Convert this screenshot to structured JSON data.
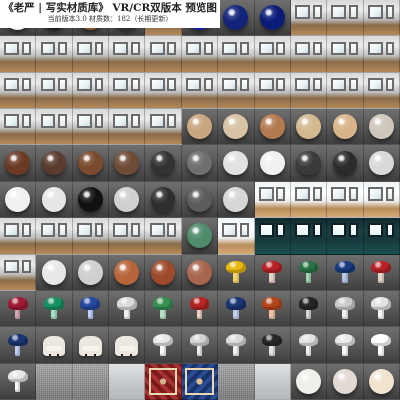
{
  "header": {
    "title": "《老严 | 写实材质库》 VR/CR双版本  预览图",
    "subtitle": "当前版本3.0 材质数：182（长期更新）"
  },
  "materials": [
    {
      "kind": "sphere",
      "color": "#f2f2f2",
      "label": "white"
    },
    {
      "kind": "sphere",
      "color": "#1a1a1a",
      "label": "black"
    },
    {
      "kind": "sphere",
      "color": "#8a5a2b",
      "label": "wood-brown"
    },
    {
      "kind": "sphere",
      "color": "#2c2c2c",
      "label": "dark"
    },
    {
      "kind": "room",
      "label": "room"
    },
    {
      "kind": "sphere",
      "color": "#0d1fa3",
      "label": "blue"
    },
    {
      "kind": "sphere",
      "color": "#12237a",
      "label": "navy"
    },
    {
      "kind": "sphere",
      "color": "#0b1b78",
      "label": "navy-2"
    },
    {
      "kind": "room",
      "label": "room"
    },
    {
      "kind": "room",
      "label": "room"
    },
    {
      "kind": "room",
      "label": "room"
    },
    {
      "kind": "room",
      "label": "room"
    },
    {
      "kind": "room",
      "label": "room"
    },
    {
      "kind": "room",
      "label": "room"
    },
    {
      "kind": "room",
      "label": "room"
    },
    {
      "kind": "room",
      "label": "room"
    },
    {
      "kind": "room",
      "label": "room"
    },
    {
      "kind": "room",
      "label": "room"
    },
    {
      "kind": "room",
      "label": "room"
    },
    {
      "kind": "room",
      "label": "room"
    },
    {
      "kind": "room",
      "label": "room"
    },
    {
      "kind": "room",
      "label": "room"
    },
    {
      "kind": "room",
      "label": "room"
    },
    {
      "kind": "room",
      "label": "room"
    },
    {
      "kind": "room",
      "label": "room"
    },
    {
      "kind": "room",
      "label": "room"
    },
    {
      "kind": "room",
      "label": "room"
    },
    {
      "kind": "room",
      "label": "room"
    },
    {
      "kind": "room",
      "label": "room"
    },
    {
      "kind": "room",
      "label": "room"
    },
    {
      "kind": "room",
      "label": "room"
    },
    {
      "kind": "room",
      "label": "room"
    },
    {
      "kind": "room",
      "label": "room"
    },
    {
      "kind": "room",
      "label": "room"
    },
    {
      "kind": "room",
      "label": "room"
    },
    {
      "kind": "room",
      "label": "room"
    },
    {
      "kind": "room",
      "label": "room"
    },
    {
      "kind": "room",
      "label": "room"
    },
    {
      "kind": "sphere",
      "color": "#c8a57f",
      "label": "sandstone"
    },
    {
      "kind": "sphere",
      "color": "#d8c3a4",
      "label": "travertine"
    },
    {
      "kind": "sphere",
      "color": "#b47a4f",
      "label": "terracotta"
    },
    {
      "kind": "sphere",
      "color": "#d3b990",
      "label": "marble-beige"
    },
    {
      "kind": "sphere",
      "color": "#d9b48a",
      "label": "marble-tan"
    },
    {
      "kind": "sphere",
      "color": "#cfc7bd",
      "label": "stone-grey"
    },
    {
      "kind": "sphere",
      "color": "#6b3a24",
      "label": "walnut"
    },
    {
      "kind": "sphere",
      "color": "#5a3b2e",
      "label": "leather"
    },
    {
      "kind": "sphere",
      "color": "#7a4a2c",
      "label": "oak-dark"
    },
    {
      "kind": "sphere",
      "color": "#6e4b35",
      "label": "oak"
    },
    {
      "kind": "sphere",
      "color": "#333333",
      "label": "graphite"
    },
    {
      "kind": "sphere",
      "color": "#6f6f6f",
      "label": "concrete"
    },
    {
      "kind": "sphere",
      "color": "#e1e1e1",
      "label": "marble-white"
    },
    {
      "kind": "sphere",
      "color": "#f0f0f0",
      "label": "marble-white-2"
    },
    {
      "kind": "sphere",
      "color": "#3a3a3a",
      "label": "marble-black"
    },
    {
      "kind": "sphere",
      "color": "#2b2b2b",
      "label": "granite-black"
    },
    {
      "kind": "sphere",
      "color": "#d9d9d9",
      "label": "marble-pearl"
    },
    {
      "kind": "sphere",
      "color": "#f1f1f1",
      "label": "white-glossy"
    },
    {
      "kind": "sphere",
      "color": "#e6e6e6",
      "label": "white-matte"
    },
    {
      "kind": "sphere",
      "color": "#111111",
      "label": "black-marble"
    },
    {
      "kind": "sphere",
      "color": "#d0d0d0",
      "label": "ceramic"
    },
    {
      "kind": "sphere",
      "color": "#2e2e2e",
      "label": "onyx"
    },
    {
      "kind": "sphere",
      "color": "#5c5c5c",
      "label": "tile"
    },
    {
      "kind": "sphere",
      "color": "#d6d6d6",
      "label": "porcelain"
    },
    {
      "kind": "room",
      "label": "room-light"
    },
    {
      "kind": "room",
      "label": "room-light"
    },
    {
      "kind": "room",
      "label": "room-light"
    },
    {
      "kind": "room",
      "label": "room-light"
    },
    {
      "kind": "room",
      "label": "room"
    },
    {
      "kind": "room",
      "label": "room"
    },
    {
      "kind": "room",
      "label": "room"
    },
    {
      "kind": "room",
      "label": "room"
    },
    {
      "kind": "room",
      "label": "room"
    },
    {
      "kind": "sphere",
      "color": "#4f8a6a",
      "label": "jade"
    },
    {
      "kind": "room",
      "label": "room-light"
    },
    {
      "kind": "room",
      "label": "room-dark"
    },
    {
      "kind": "room",
      "label": "room-dark"
    },
    {
      "kind": "room",
      "label": "room-dark"
    },
    {
      "kind": "room",
      "label": "room-dark"
    },
    {
      "kind": "room",
      "label": "room"
    },
    {
      "kind": "sphere",
      "color": "#e8e8e8",
      "label": "white"
    },
    {
      "kind": "sphere",
      "color": "#cfcfcf",
      "label": "stone"
    },
    {
      "kind": "sphere",
      "color": "#b8643a",
      "label": "rattan"
    },
    {
      "kind": "sphere",
      "color": "#9d4a2a",
      "label": "brick"
    },
    {
      "kind": "sphere",
      "color": "#a6654c",
      "label": "clay"
    },
    {
      "kind": "mushroom",
      "cap": "#e6b400",
      "stem": "#f1d36a",
      "label": "mushroom-yellow"
    },
    {
      "kind": "mushroom",
      "cap": "#b4161b",
      "stem": "#e6d1c7",
      "label": "mushroom-red"
    },
    {
      "kind": "mushroom",
      "cap": "#1f6b3b",
      "stem": "#a5d2b4",
      "label": "mushroom-green"
    },
    {
      "kind": "mushroom",
      "cap": "#0b2f7a",
      "stem": "#b7c6e8",
      "label": "mushroom-blue"
    },
    {
      "kind": "mushroom",
      "cap": "#b4161b",
      "stem": "#e6d1c7",
      "label": "mushroom-red-2"
    },
    {
      "kind": "mushroom",
      "cap": "#9a0f2a",
      "stem": "#d5a8b3",
      "label": "mushroom-maroon"
    },
    {
      "kind": "mushroom",
      "cap": "#0b8a5a",
      "stem": "#a4e0c3",
      "label": "mushroom-teal"
    },
    {
      "kind": "mushroom",
      "cap": "#1a3f9a",
      "stem": "#bdd0ff",
      "label": "mushroom-blue-2"
    },
    {
      "kind": "mushroom",
      "cap": "#d8d8d8",
      "stem": "#efefef",
      "label": "mushroom-white"
    },
    {
      "kind": "mushroom",
      "cap": "#2a8a48",
      "stem": "#b7e2c5",
      "label": "mushroom-green-2"
    },
    {
      "kind": "mushroom",
      "cap": "#b01818",
      "stem": "#f0d2c2",
      "label": "mushroom-red-3"
    },
    {
      "kind": "mushroom",
      "cap": "#0d2b6c",
      "stem": "#c0ccf0",
      "label": "mushroom-navy"
    },
    {
      "kind": "mushroom",
      "cap": "#b03a0e",
      "stem": "#f1c2a5",
      "label": "mushroom-orange"
    },
    {
      "kind": "mushroom",
      "cap": "#1a1a1a",
      "stem": "#d7d7d7",
      "label": "mushroom-black"
    },
    {
      "kind": "mushroom",
      "cap": "#c7c7c7",
      "stem": "#f2f2f2",
      "label": "mushroom-grey"
    },
    {
      "kind": "mushroom",
      "cap": "#e0e0e0",
      "stem": "#f6f6f6",
      "label": "mushroom-white-2"
    },
    {
      "kind": "mushroom",
      "cap": "#0d2b6c",
      "stem": "#c0ccf0",
      "label": "mushroom-navy-2"
    },
    {
      "kind": "chair",
      "label": "chair"
    },
    {
      "kind": "chair",
      "label": "chair"
    },
    {
      "kind": "chair",
      "label": "chair"
    },
    {
      "kind": "mushroom",
      "cap": "#e6e6e6",
      "stem": "#f7f7f7",
      "label": "mushroom-white-3"
    },
    {
      "kind": "mushroom",
      "cap": "#d2d2d2",
      "stem": "#efefef",
      "label": "mushroom-white-4"
    },
    {
      "kind": "mushroom",
      "cap": "#d8d8d8",
      "stem": "#f2f2f2",
      "label": "mushroom-white-5"
    },
    {
      "kind": "mushroom",
      "cap": "#1c1c1c",
      "stem": "#e3e3e3",
      "label": "mushroom-black-2"
    },
    {
      "kind": "mushroom",
      "cap": "#e0e0e0",
      "stem": "#f6f6f6",
      "label": "mushroom-white-6"
    },
    {
      "kind": "mushroom",
      "cap": "#e8e8e8",
      "stem": "#ffffff",
      "label": "mushroom-white-7"
    },
    {
      "kind": "mushroom",
      "cap": "#ffffff",
      "stem": "#ffffff",
      "label": "mushroom-white-8"
    },
    {
      "kind": "mushroom",
      "cap": "#e6e6e6",
      "stem": "#f7f7f7",
      "label": "mushroom-white-9"
    },
    {
      "kind": "fabric",
      "label": "fabric-grey"
    },
    {
      "kind": "fabric",
      "label": "fabric-grey-2"
    },
    {
      "kind": "white-floor",
      "label": "floor-white"
    },
    {
      "kind": "rug-red",
      "label": "rug-red"
    },
    {
      "kind": "rug-blue",
      "label": "rug-blue"
    },
    {
      "kind": "fabric",
      "label": "fabric-grey-3"
    },
    {
      "kind": "white-floor",
      "label": "floor-white-2"
    },
    {
      "kind": "sphere",
      "color": "#efeee8",
      "label": "pearl"
    },
    {
      "kind": "sphere",
      "color": "#e2d9d2",
      "label": "ivory"
    },
    {
      "kind": "sphere",
      "color": "#f0e4cf",
      "label": "glow"
    }
  ]
}
